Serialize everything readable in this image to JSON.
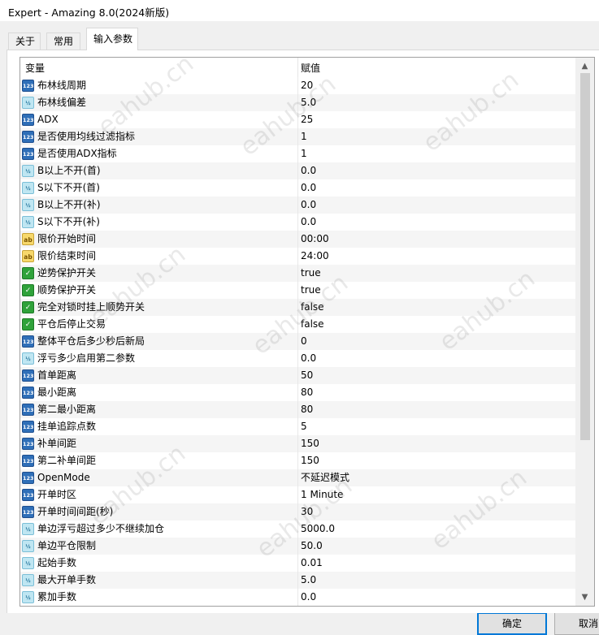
{
  "window": {
    "title": "Expert - Amazing 8.0(2024新版)"
  },
  "tabs": [
    {
      "label": "关于"
    },
    {
      "label": "常用"
    },
    {
      "label": "输入参数"
    }
  ],
  "grid": {
    "col_variable": "变量",
    "col_value": "赋值",
    "type_icons": {
      "int": "123",
      "double": "½",
      "string": "ab",
      "bool": "✓"
    },
    "rows": [
      {
        "type": "int",
        "name": "布林线周期",
        "value": "20"
      },
      {
        "type": "double",
        "name": "布林线偏差",
        "value": "5.0"
      },
      {
        "type": "int",
        "name": "ADX",
        "value": "25"
      },
      {
        "type": "int",
        "name": "是否使用均线过滤指标",
        "value": "1"
      },
      {
        "type": "int",
        "name": "是否使用ADX指标",
        "value": "1"
      },
      {
        "type": "double",
        "name": "B以上不开(首)",
        "value": "0.0"
      },
      {
        "type": "double",
        "name": "S以下不开(首)",
        "value": "0.0"
      },
      {
        "type": "double",
        "name": "B以上不开(补)",
        "value": "0.0"
      },
      {
        "type": "double",
        "name": "S以下不开(补)",
        "value": "0.0"
      },
      {
        "type": "string",
        "name": "限价开始时间",
        "value": "00:00"
      },
      {
        "type": "string",
        "name": "限价结束时间",
        "value": "24:00"
      },
      {
        "type": "bool",
        "name": "逆势保护开关",
        "value": "true"
      },
      {
        "type": "bool",
        "name": "顺势保护开关",
        "value": "true"
      },
      {
        "type": "bool",
        "name": "完全对锁时挂上顺势开关",
        "value": "false"
      },
      {
        "type": "bool",
        "name": "平仓后停止交易",
        "value": "false"
      },
      {
        "type": "int",
        "name": "整体平仓后多少秒后新局",
        "value": "0"
      },
      {
        "type": "double",
        "name": "浮亏多少启用第二参数",
        "value": "0.0"
      },
      {
        "type": "int",
        "name": "首单距离",
        "value": "50"
      },
      {
        "type": "int",
        "name": "最小距离",
        "value": "80"
      },
      {
        "type": "int",
        "name": "第二最小距离",
        "value": "80"
      },
      {
        "type": "int",
        "name": "挂单追踪点数",
        "value": "5"
      },
      {
        "type": "int",
        "name": "补单间距",
        "value": "150"
      },
      {
        "type": "int",
        "name": "第二补单间距",
        "value": "150"
      },
      {
        "type": "int",
        "name": "OpenMode",
        "value": "不延迟模式"
      },
      {
        "type": "int",
        "name": "开单时区",
        "value": "1 Minute"
      },
      {
        "type": "int",
        "name": "开单时间间距(秒)",
        "value": "30"
      },
      {
        "type": "double",
        "name": "单边浮亏超过多少不继续加仓",
        "value": "5000.0"
      },
      {
        "type": "double",
        "name": "单边平仓限制",
        "value": "50.0"
      },
      {
        "type": "double",
        "name": "起始手数",
        "value": "0.01"
      },
      {
        "type": "double",
        "name": "最大开单手数",
        "value": "5.0"
      },
      {
        "type": "double",
        "name": "累加手数",
        "value": "0.0"
      }
    ]
  },
  "scrollbar": {
    "up": "▲",
    "down": "▼"
  },
  "buttons": {
    "ok": "确定",
    "cancel": "取消"
  },
  "watermark": "eahub.cn"
}
